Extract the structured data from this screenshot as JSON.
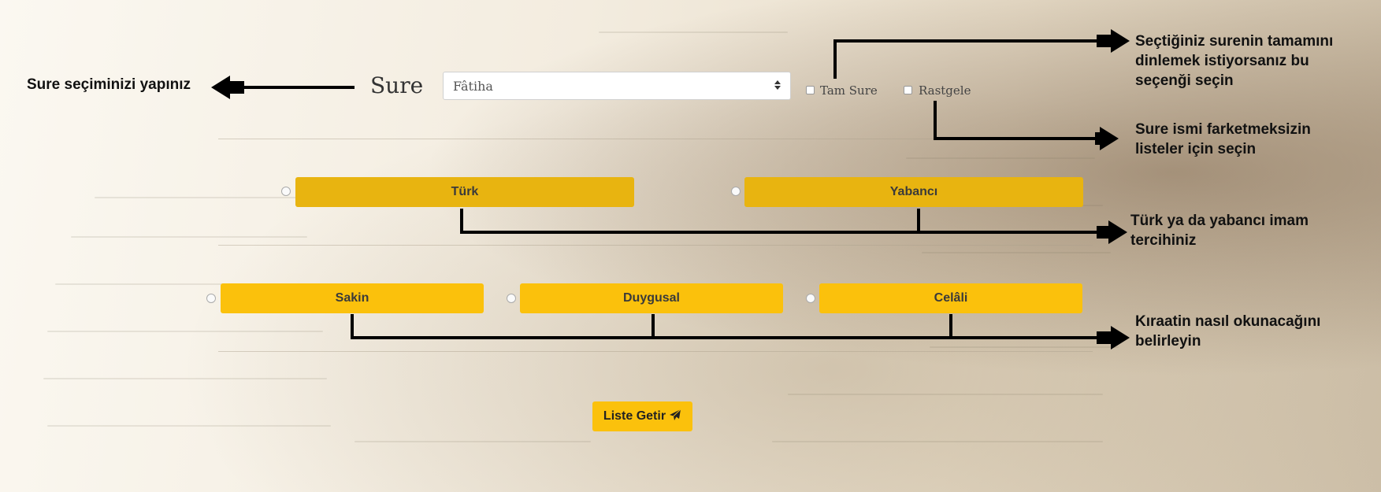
{
  "form": {
    "sure_label": "Sure",
    "sure_select_value": "Fâtiha",
    "tam_sure_label": "Tam Sure",
    "rastgele_label": "Rastgele",
    "imam_options": [
      "Türk",
      "Yabancı"
    ],
    "style_options": [
      "Sakin",
      "Duygusal",
      "Celâli"
    ],
    "submit_label": "Liste Getir"
  },
  "annotations": {
    "select_hint": "Sure seçiminizi yapınız",
    "tam_sure_hint": [
      "Seçtiğiniz surenin tamamını",
      "dinlemek istiyorsanız bu",
      "seçenği seçin"
    ],
    "rastgele_hint": [
      "Sure ismi farketmeksizin",
      "listeler için seçin"
    ],
    "imam_hint": [
      "Türk ya da yabancı imam",
      "tercihiniz"
    ],
    "style_hint": [
      "Kıraatin nasıl okunacağını",
      "belirleyin"
    ]
  },
  "colors": {
    "button_dark": "#e8b410",
    "button_light": "#fbc10c"
  },
  "icons": {
    "select": "sort-caret-icon",
    "submit": "paper-plane-icon"
  }
}
